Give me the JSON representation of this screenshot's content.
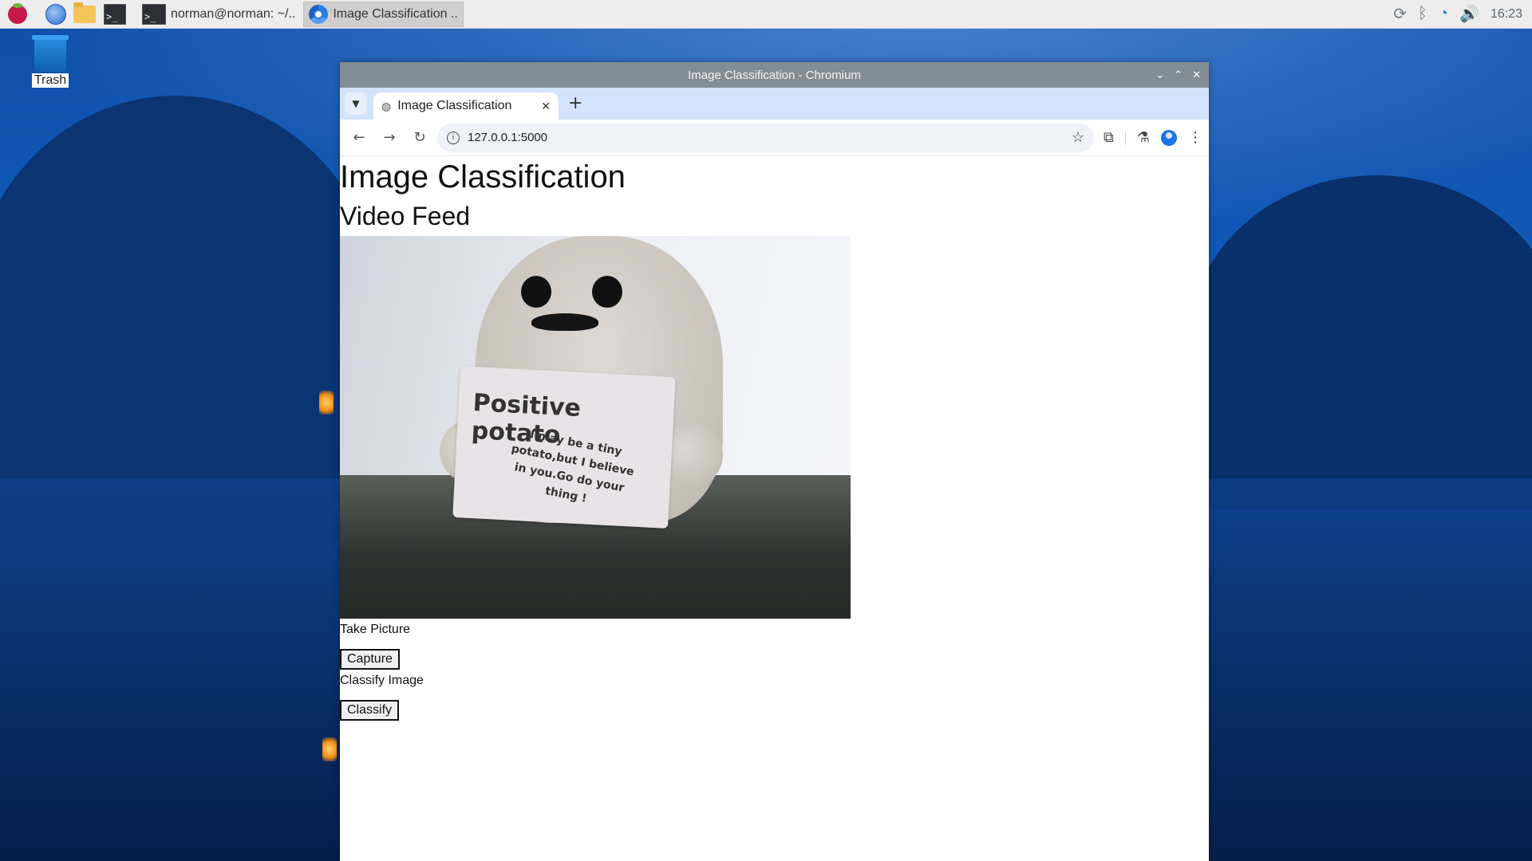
{
  "taskbar": {
    "tasks": [
      {
        "label": "norman@norman: ~/..",
        "icon": "terminal-icon"
      },
      {
        "label": "Image Classification ..",
        "icon": "chromium-icon"
      }
    ],
    "clock": "16:23"
  },
  "desktop": {
    "trash_label": "Trash"
  },
  "window": {
    "title": "Image Classification - Chromium",
    "tab": {
      "title": "Image Classification"
    },
    "address": "127.0.0.1:5000"
  },
  "page": {
    "heading": "Image Classification",
    "subheading": "Video Feed",
    "video_sign_title": "Positive potato",
    "video_sign_text": "I may be a tiny potato,but I believe in you.Go do your thing !",
    "take_picture_label": "Take Picture",
    "capture_button": "Capture",
    "classify_label": "Classify Image",
    "classify_button": "Classify"
  },
  "colors": {
    "tabstrip": "#d3e3fd",
    "titlebar": "#848c94",
    "accent": "#1a73e8"
  }
}
